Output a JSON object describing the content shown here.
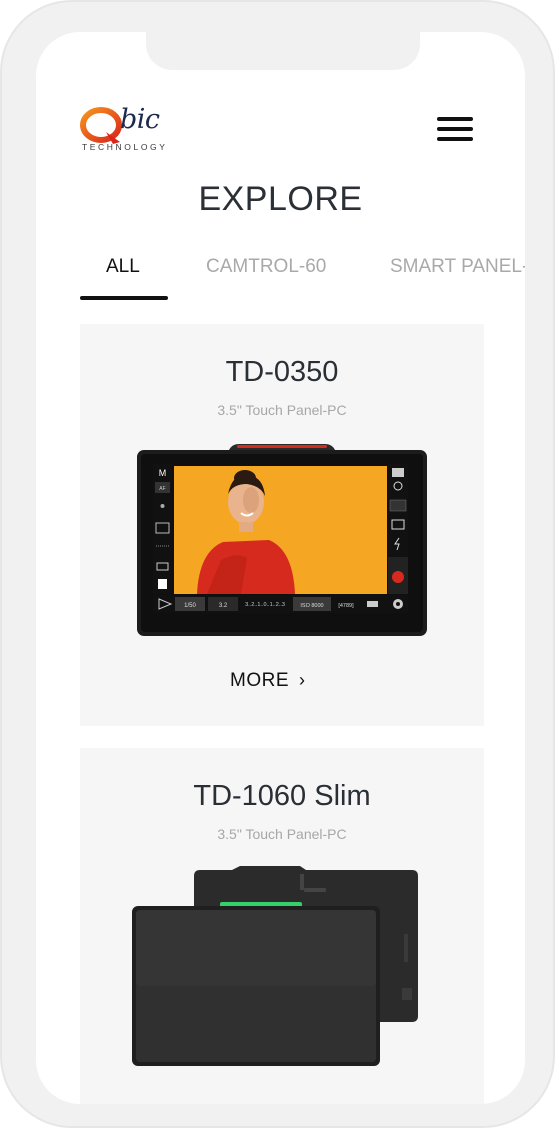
{
  "brand": {
    "logo_letters": "Qbic",
    "logo_word": "bic",
    "logo_tagline": "TECHNOLOGY"
  },
  "header": {
    "menu_icon": "hamburger-icon"
  },
  "page": {
    "title": "EXPLORE"
  },
  "tabs": [
    {
      "label": "ALL",
      "active": true
    },
    {
      "label": "CAMTROL-60",
      "active": false
    },
    {
      "label": "SMART PANEL-",
      "active": false
    }
  ],
  "products": [
    {
      "name": "TD-0350",
      "subtitle": "3.5\" Touch Panel-PC",
      "more_label": "MORE",
      "more_icon": "chevron-right-icon",
      "screen_ui": {
        "mode": "M",
        "af": "AF",
        "shutter": "1/50",
        "aperture": "3.2",
        "exposure_scale": "3..2..1..0..1..2..3",
        "iso": "ISO 8000",
        "shots": "[4789]"
      }
    },
    {
      "name": "TD-1060 Slim",
      "subtitle": "3.5\" Touch Panel-PC"
    }
  ],
  "colors": {
    "accent_orange": "#f07a1a",
    "accent_red": "#d72a1f",
    "card_bg": "#f6f6f6",
    "screen_orange": "#f5a623"
  }
}
